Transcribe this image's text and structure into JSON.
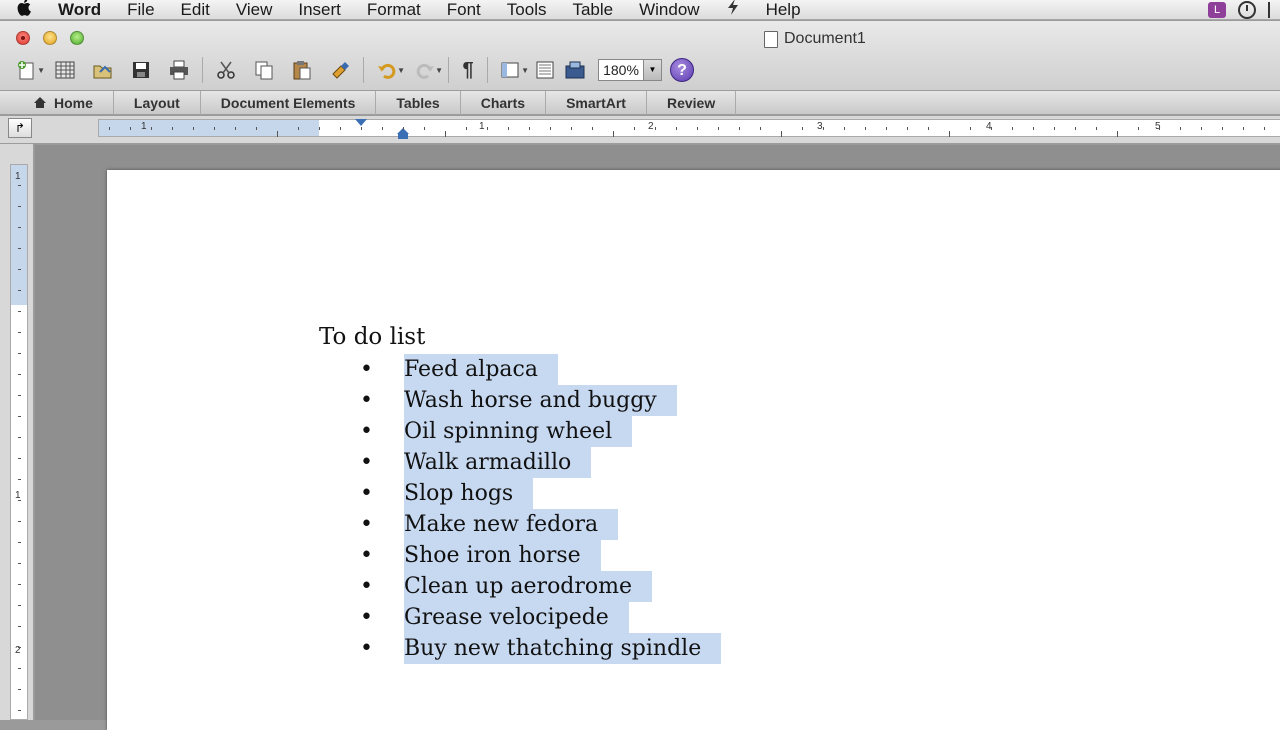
{
  "menubar": {
    "app_name": "Word",
    "items": [
      "File",
      "Edit",
      "View",
      "Insert",
      "Format",
      "Font",
      "Tools",
      "Table",
      "Window",
      "Help"
    ],
    "user_badge": "L"
  },
  "window": {
    "title": "Document1"
  },
  "toolbar": {
    "zoom": "180%",
    "help_label": "?",
    "paragraph_mark": "¶"
  },
  "ribbon": {
    "tabs": [
      "Home",
      "Layout",
      "Document Elements",
      "Tables",
      "Charts",
      "SmartArt",
      "Review"
    ]
  },
  "ruler": {
    "numbers": [
      "1",
      "1",
      "2",
      "3",
      "4",
      "5"
    ],
    "vnumbers": [
      "1",
      "1",
      "2"
    ]
  },
  "document": {
    "heading": "To do list",
    "bullet_char": "•",
    "items": [
      "Feed alpaca",
      "Wash horse and buggy",
      "Oil spinning wheel",
      "Walk armadillo",
      "Slop hogs",
      "Make new fedora",
      "Shoe iron horse",
      "Clean up aerodrome",
      "Grease velocipede",
      "Buy new thatching spindle"
    ]
  },
  "colors": {
    "selection": "#c7d9f1",
    "ruler_shade": "#c6d7ec",
    "accent": "#3b6fb5"
  }
}
